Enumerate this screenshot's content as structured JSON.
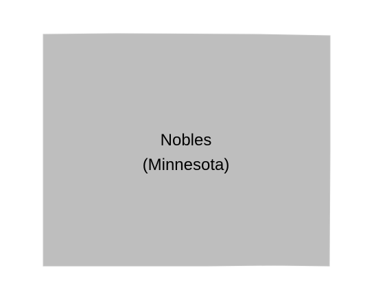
{
  "map": {
    "region": {
      "name": "Nobles",
      "state": "(Minnesota)",
      "fill_color": "#bebebe",
      "border_color": "#c8c8c8"
    },
    "background_color": "#ffffff"
  }
}
